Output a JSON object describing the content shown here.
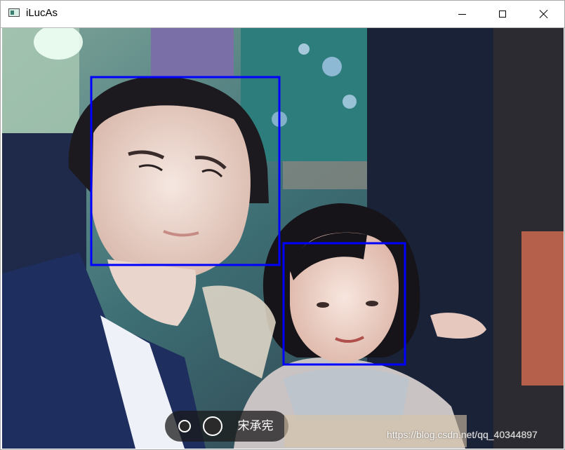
{
  "window": {
    "title": "iLucAs",
    "controls": [
      "minimize",
      "maximize",
      "close"
    ]
  },
  "icons": {
    "app": "app-window-icon",
    "minimize": "minimize-icon",
    "maximize": "maximize-icon",
    "close": "close-icon"
  },
  "frame": {
    "caption": "宋承宪",
    "watermark": "https://blog.csdn.net/qq_40344897"
  },
  "detections": {
    "box_color": "#0000ff",
    "faces": [
      {
        "label": "face-1"
      },
      {
        "label": "face-2"
      }
    ]
  }
}
